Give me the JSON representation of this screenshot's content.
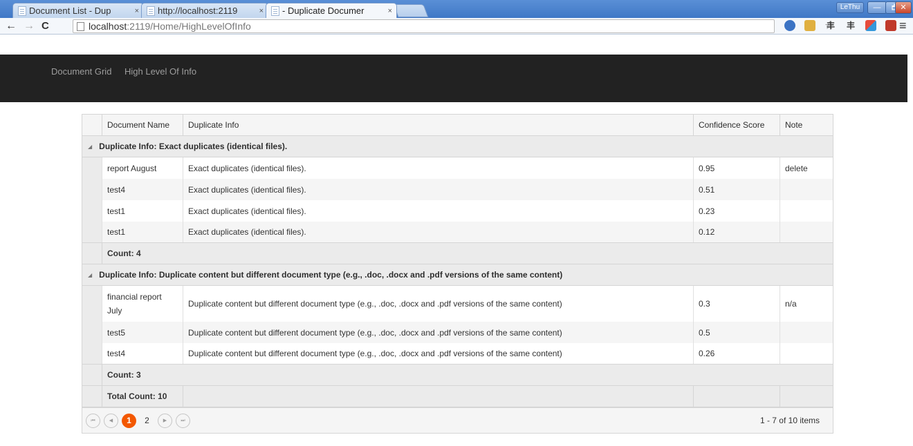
{
  "browser": {
    "tabs": [
      {
        "title": "Document List - Dup",
        "active": false
      },
      {
        "title": "http://localhost:2119",
        "active": false
      },
      {
        "title": "- Duplicate Documer",
        "active": true
      }
    ],
    "close_glyph": "×",
    "user": "LeThu",
    "window_controls": {
      "minimize": "—",
      "restore": "🗗",
      "close": "✕"
    },
    "url_host": "localhost",
    "url_path": ":2119/Home/HighLevelOfInfo",
    "nav": {
      "back": "←",
      "forward": "→",
      "reload": "C"
    },
    "star": "☆",
    "menu": "≡"
  },
  "navbar": {
    "links": [
      "Document Grid",
      "High Level Of Info"
    ]
  },
  "grid": {
    "columns": [
      "Document Name",
      "Duplicate Info",
      "Confidence Score",
      "Note"
    ],
    "groups": [
      {
        "label": "Duplicate Info: Exact duplicates (identical files).",
        "rows": [
          {
            "name": "report August",
            "info": "Exact duplicates (identical files).",
            "score": "0.95",
            "note": "delete"
          },
          {
            "name": "test4",
            "info": "Exact duplicates (identical files).",
            "score": "0.51",
            "note": ""
          },
          {
            "name": "test1",
            "info": "Exact duplicates (identical files).",
            "score": "0.23",
            "note": ""
          },
          {
            "name": "test1",
            "info": "Exact duplicates (identical files).",
            "score": "0.12",
            "note": ""
          }
        ],
        "footer": "Count: 4"
      },
      {
        "label": "Duplicate Info: Duplicate content but different document type (e.g., .doc, .docx and .pdf versions of the same content)",
        "rows": [
          {
            "name": "financial report July",
            "info": "Duplicate content but different document type (e.g., .doc, .docx and .pdf versions of the same content)",
            "score": "0.3",
            "note": "n/a"
          },
          {
            "name": "test5",
            "info": "Duplicate content but different document type (e.g., .doc, .docx and .pdf versions of the same content)",
            "score": "0.5",
            "note": ""
          },
          {
            "name": "test4",
            "info": "Duplicate content but different document type (e.g., .doc, .docx and .pdf versions of the same content)",
            "score": "0.26",
            "note": ""
          }
        ],
        "footer": "Count: 3"
      }
    ],
    "total": "Total Count: 10",
    "pager": {
      "first": "⏮",
      "prev": "◀",
      "next": "▶",
      "last": "⏭",
      "pages": [
        "1",
        "2"
      ],
      "current_page": "1",
      "info": "1 - 7 of 10 items"
    }
  },
  "colors": {
    "navbar_bg": "#222222",
    "accent_orange": "#f35800",
    "grid_border": "#d5d5d5"
  }
}
